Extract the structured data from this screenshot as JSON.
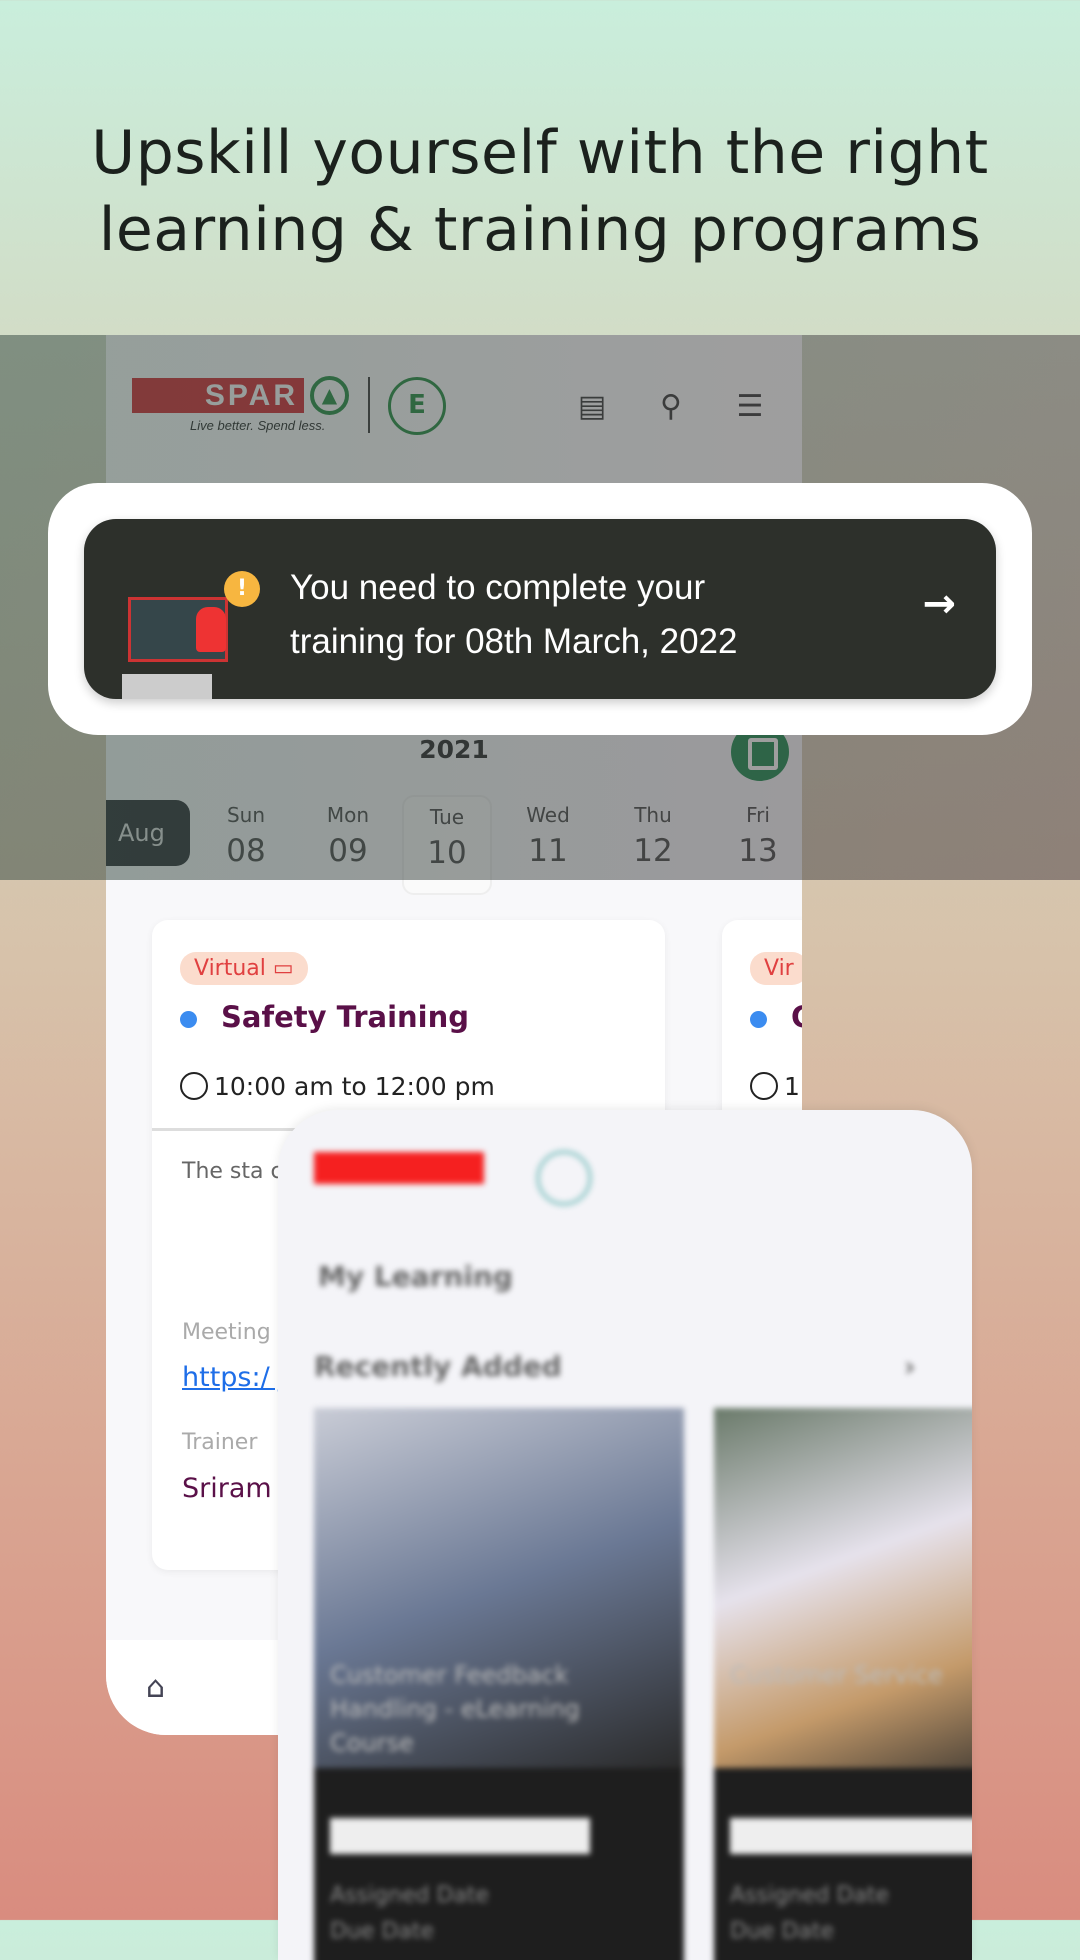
{
  "headline": {
    "line1": "Upskill yourself with the right",
    "line2": "learning & training programs"
  },
  "app_header": {
    "brand": "SPAR",
    "tagline": "Live better. Spend less.",
    "sub_logo": "E",
    "icons": [
      "news-icon",
      "search-icon",
      "menu-icon"
    ]
  },
  "alert": {
    "line1": "You need to complete your",
    "line2": "training for 08th March, 2022",
    "icon": "warning-icon",
    "action_icon": "arrow-right-icon"
  },
  "calendar": {
    "year": "2021",
    "month": "Aug",
    "days": [
      {
        "name": "Sun",
        "date": "08"
      },
      {
        "name": "Mon",
        "date": "09"
      },
      {
        "name": "Tue",
        "date": "10",
        "selected": true
      },
      {
        "name": "Wed",
        "date": "11"
      },
      {
        "name": "Thu",
        "date": "12"
      },
      {
        "name": "Fri",
        "date": "13"
      }
    ]
  },
  "event": {
    "badge": "Virtual",
    "title": "Safety Training",
    "time": "10:00 am to 12:00 pm",
    "description": "The sta condition harm o",
    "meeting_label": "Meeting",
    "link": "https:/ ju-fmn",
    "trainer_label": "Trainer",
    "trainer": "Sriram"
  },
  "event2": {
    "badge": "Vir",
    "title": "C",
    "time": "1"
  },
  "second_screen": {
    "title": "My Learning",
    "section": "Recently Added",
    "cards": [
      {
        "title": "Customer Feedback Handling - eLearning Course",
        "assigned": "Assigned Date",
        "due": "Due Date"
      },
      {
        "title": "Customer Service",
        "assigned": "Assigned Date",
        "due": "Due Date"
      }
    ]
  },
  "colors": {
    "accent_green": "#17894a",
    "brand_red": "#d4232b",
    "banner_bg": "#2d302b",
    "title_purple": "#5a1048"
  }
}
